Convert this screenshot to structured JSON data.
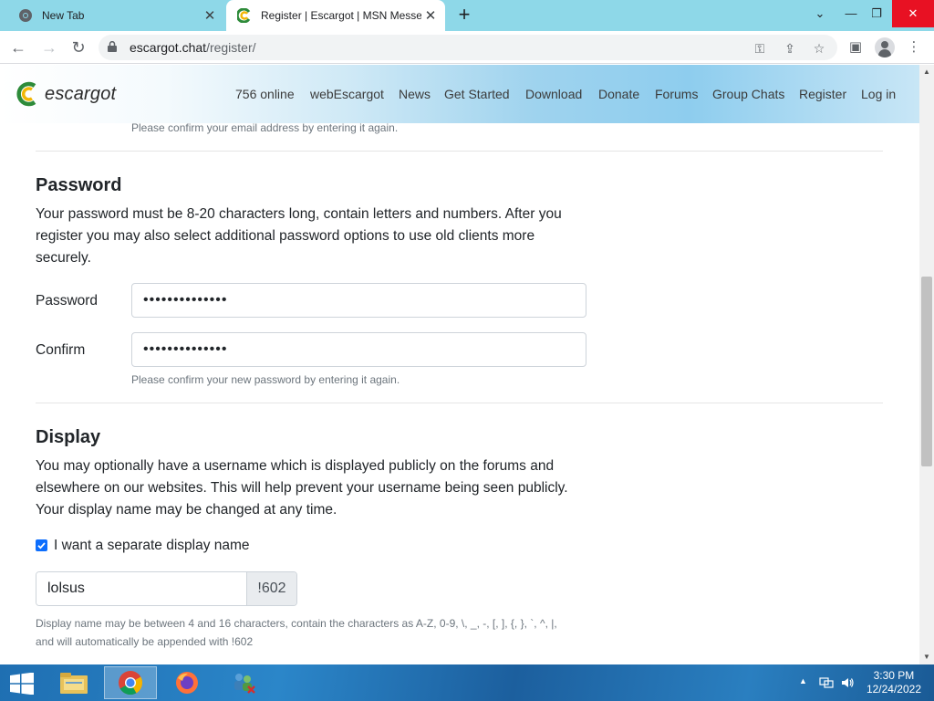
{
  "browser": {
    "tabs": [
      {
        "title": "New Tab",
        "active": false
      },
      {
        "title": "Register | Escargot | MSN Messen",
        "active": true
      }
    ],
    "new_tab_label": "+",
    "url_host": "escargot.chat",
    "url_path": "/register/"
  },
  "site": {
    "logo_text": "escargot",
    "nav": [
      "756 online",
      "webEscargot",
      "News",
      "Get Started",
      "Download",
      "Donate",
      "Forums",
      "Group Chats",
      "Register",
      "Log in"
    ]
  },
  "form": {
    "email_confirm_help": "Please confirm your email address by entering it again.",
    "password_section": {
      "heading": "Password",
      "description": "Your password must be 8-20 characters long, contain letters and numbers. After you register you may also select additional password options to use old clients more securely.",
      "password_label": "Password",
      "password_value": "••••••••••••••",
      "confirm_label": "Confirm",
      "confirm_value": "••••••••••••••",
      "confirm_help": "Please confirm your new password by entering it again."
    },
    "display_section": {
      "heading": "Display",
      "description": "You may optionally have a username which is displayed publicly on the forums and elsewhere on our websites. This will help prevent your username being seen publicly. Your display name may be changed at any time.",
      "checkbox_label": "I want a separate display name",
      "checkbox_checked": true,
      "display_name_value": "lolsus",
      "display_suffix": "!602",
      "help_line1": "Display name may be between 4 and 16 characters, contain the characters as A-Z, 0-9, \\, _, -, [, ], {, }, `, ^, |,",
      "help_line2": "and will automatically be appended with !602"
    }
  },
  "taskbar": {
    "time": "3:30 PM",
    "date": "12/24/2022",
    "apps": [
      "file-explorer",
      "chrome",
      "firefox",
      "network-app"
    ]
  },
  "colors": {
    "tabstrip": "#8ed8e8",
    "checkbox": "#0d6efd",
    "close_button": "#e81123"
  }
}
